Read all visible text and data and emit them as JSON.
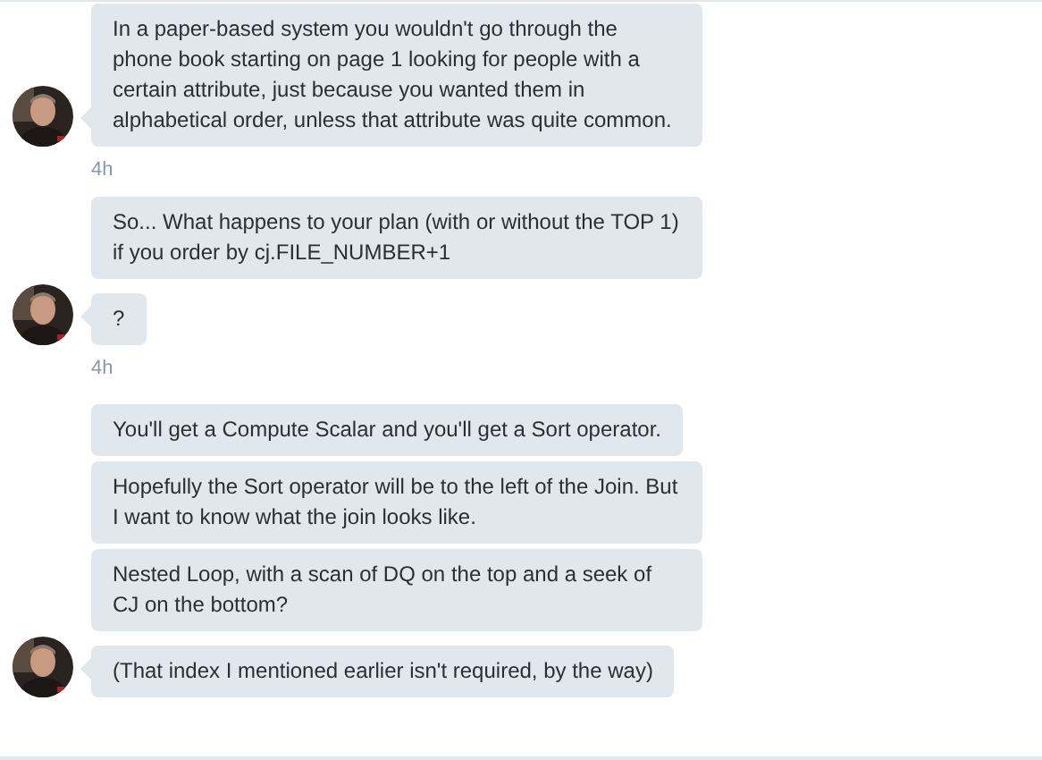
{
  "groups": [
    {
      "messages": [
        "In a paper-based system you wouldn't go through the phone book starting on page 1 looking for people with a certain attribute, just because you wanted them in alphabetical order, unless that attribute was quite common."
      ],
      "time": "4h"
    },
    {
      "messages": [
        "So... What happens to your plan (with or without the TOP 1) if you order by cj.FILE_NUMBER+1",
        "?"
      ],
      "time": "4h"
    },
    {
      "messages": [
        "You'll get a Compute Scalar and you'll get a Sort operator.",
        "Hopefully the Sort operator will be to the left of the Join. But I want to know what the join looks like.",
        "Nested Loop, with a scan of DQ on the top and a seek of CJ on the bottom?",
        "(That index I mentioned earlier isn't required, by the way)"
      ]
    }
  ]
}
